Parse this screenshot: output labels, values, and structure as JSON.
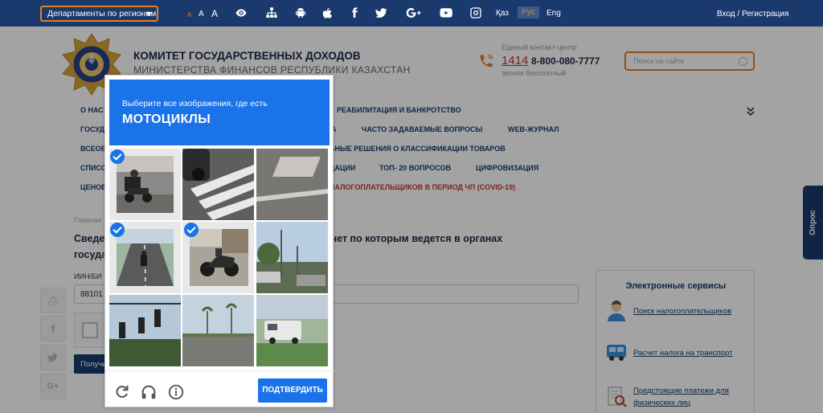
{
  "topbar": {
    "departments_label": "Департаменты по регионам",
    "font_sizes": [
      "A",
      "A",
      "A"
    ],
    "icons": [
      "eye-icon",
      "sitemap-icon",
      "android-icon",
      "apple-icon",
      "facebook-icon",
      "twitter-icon",
      "google-plus-icon",
      "youtube-icon",
      "instagram-icon"
    ],
    "languages": [
      "Қаз",
      "Рус",
      "Eng"
    ],
    "active_language": "Рус",
    "login": "Вход / Регистрация",
    "bg_color": "#1a3a6e",
    "accent_color": "#e67e22"
  },
  "header": {
    "title": "КОМИТЕТ ГОСУДАРСТВЕННЫХ ДОХОДОВ",
    "subtitle": "МИНИСТЕРСТВА ФИНАНСОВ РЕСПУБЛИКИ КАЗАХСТАН",
    "contact_label": "Единый контакт-центр",
    "short_number": "1414",
    "phone": "8-800-080-7777",
    "free_call": "звонок бесплатный",
    "search_placeholder": "Поиск на сайте"
  },
  "nav": {
    "row1": [
      "О НАС",
      "РЕАБИЛИТАЦИЯ И БАНКРОТСТВО"
    ],
    "row2": [
      "ГОСУД",
      "А",
      "ЧАСТО ЗАДАВАЕМЫЕ ВОПРОСЫ",
      "WEB-ЖУРНАЛ"
    ],
    "row3": [
      "ВСЕОБ",
      "ЬНЫЕ РЕШЕНИЯ О КЛАССИФИКАЦИИ ТОВАРОВ"
    ],
    "row4": [
      "СПИСО",
      "ДАЦИИ",
      "ТОП- 20 ВОПРОСОВ",
      "ЦИФРОВИЗАЦИЯ"
    ],
    "row5": [
      "ЦЕНОВ",
      "НАЛОГОПЛАТЕЛЬЩИКОВ В ПЕРИОД ЧП (COVID-19)"
    ]
  },
  "main": {
    "breadcrumb": "Главная",
    "heading_left_1": "Сведе",
    "heading_left_2": "госуда",
    "heading_right": ", учет по которым ведется в органах",
    "iin_label": "ИИН/БИ",
    "iin_value": "88101",
    "submit_label": "Получить"
  },
  "share": [
    "print-icon",
    "facebook-icon",
    "twitter-icon",
    "google-plus-icon"
  ],
  "eservices": {
    "title": "Электронные сервисы",
    "items": [
      "Поиск налогоплательщиков",
      "Расчет налога на транспорт",
      "Предстоящие платежи для",
      "физических лиц"
    ]
  },
  "poll_tab": "Опрос",
  "captcha": {
    "instruction": "Выберите все изображения, где есть",
    "target": "мотоциклы",
    "verify_label": "ПОДТВЕРДИТЬ",
    "selected_tiles": [
      0,
      3,
      4
    ],
    "accent_color": "#1a73e8"
  }
}
